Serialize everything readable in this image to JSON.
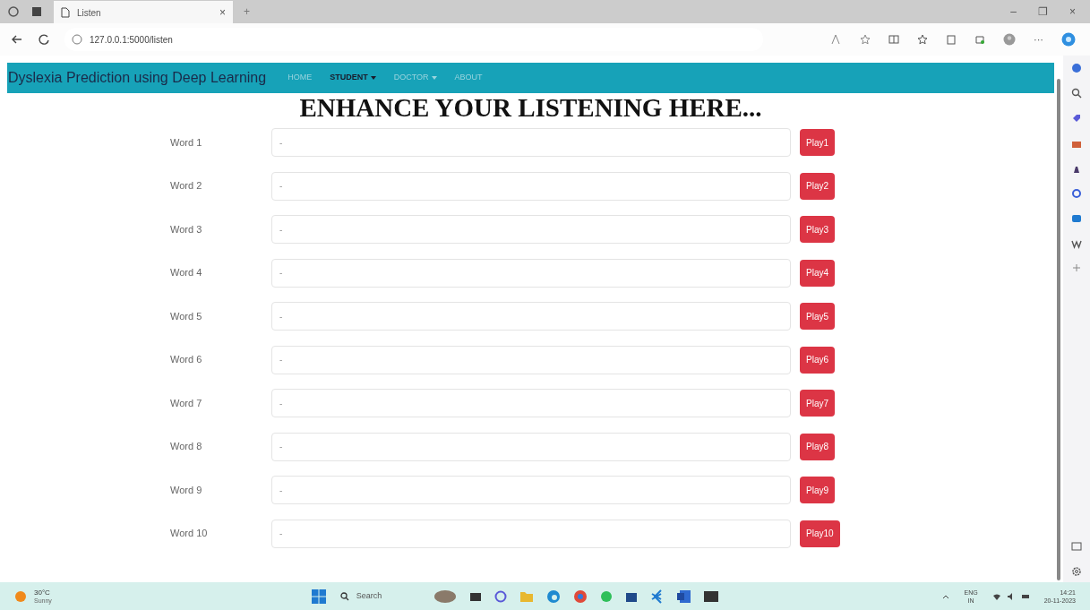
{
  "browser": {
    "tab_title": "Listen",
    "tab_close": "×",
    "new_tab": "+",
    "url": "127.0.0.1:5000/listen",
    "window_controls": [
      "–",
      "❐",
      "×"
    ],
    "more": "···"
  },
  "navbar": {
    "brand": "Dyslexia Prediction using Deep Learning",
    "items": [
      {
        "label": "HOME",
        "dropdown": false,
        "selected": false
      },
      {
        "label": "STUDENT",
        "dropdown": true,
        "selected": true
      },
      {
        "label": "DOCTOR",
        "dropdown": true,
        "selected": false
      },
      {
        "label": "ABOUT",
        "dropdown": false,
        "selected": false
      }
    ]
  },
  "heading": "ENHANCE YOUR LISTENING HERE...",
  "rows": [
    {
      "label": "Word 1",
      "value": "-",
      "button": "Play1"
    },
    {
      "label": "Word 2",
      "value": "-",
      "button": "Play2"
    },
    {
      "label": "Word 3",
      "value": "-",
      "button": "Play3"
    },
    {
      "label": "Word 4",
      "value": "-",
      "button": "Play4"
    },
    {
      "label": "Word 5",
      "value": "-",
      "button": "Play5"
    },
    {
      "label": "Word 6",
      "value": "-",
      "button": "Play6"
    },
    {
      "label": "Word 7",
      "value": "-",
      "button": "Play7"
    },
    {
      "label": "Word 8",
      "value": "-",
      "button": "Play8"
    },
    {
      "label": "Word 9",
      "value": "-",
      "button": "Play9"
    },
    {
      "label": "Word 10",
      "value": "-",
      "button": "Play10"
    }
  ],
  "taskbar": {
    "temperature": "30°C",
    "weather": "Sunny",
    "search": "Search",
    "language": "ENG",
    "region": "IN",
    "time": "14:21",
    "date": "20-11-2023"
  }
}
